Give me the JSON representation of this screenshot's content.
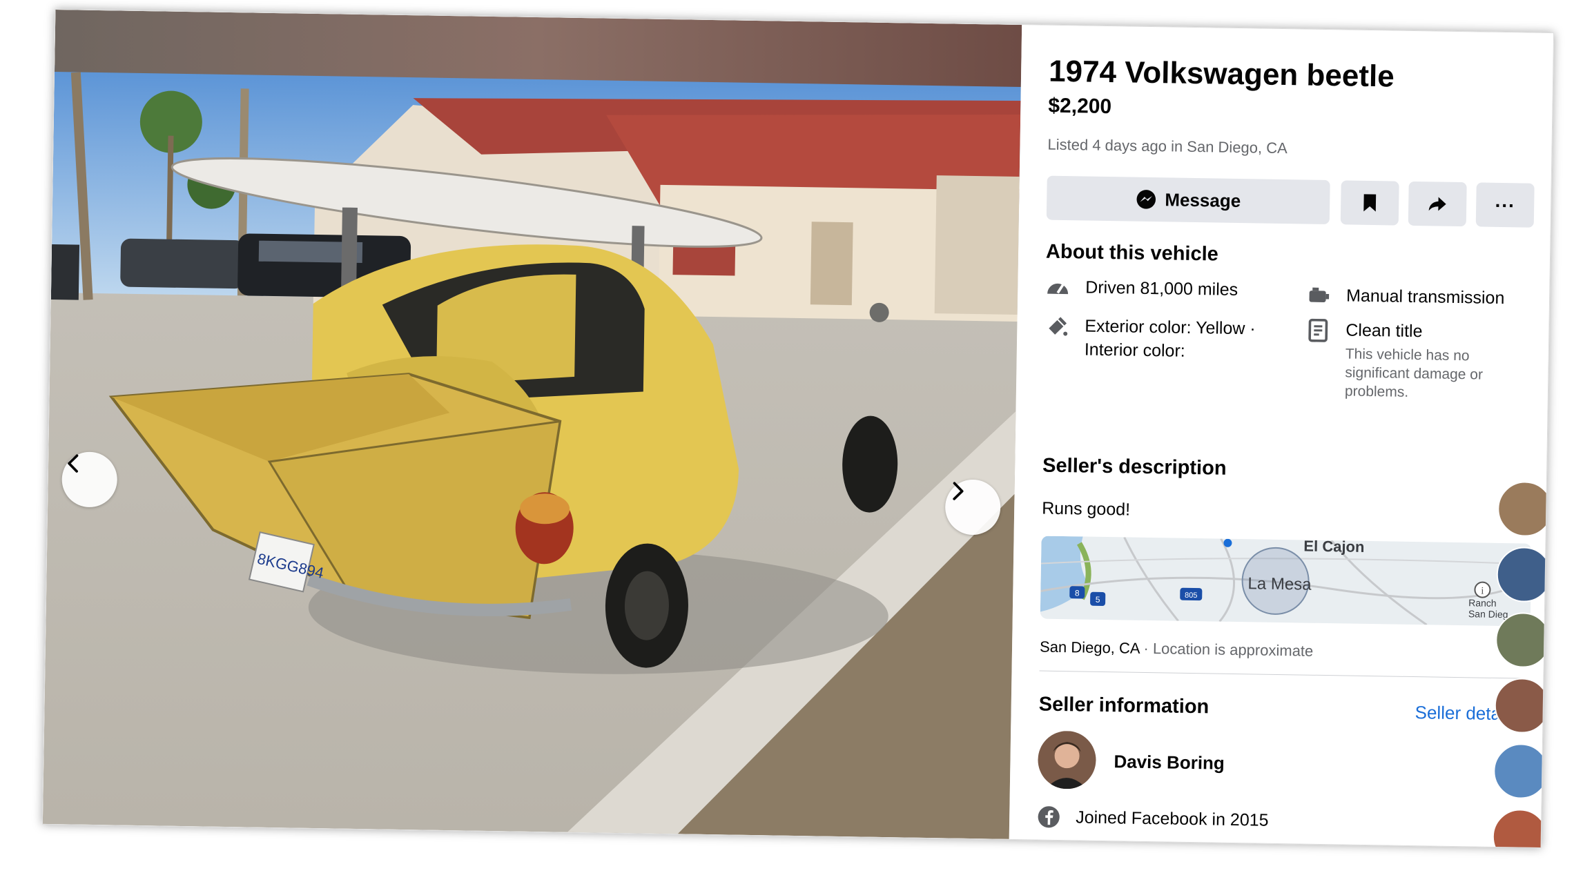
{
  "listing": {
    "title": "1974 Volkswagen beetle",
    "price": "$2,200",
    "listed": "Listed 4 days ago in San Diego, CA"
  },
  "actions": {
    "message_label": "Message",
    "icons": [
      "save-icon",
      "share-icon",
      "more-icon"
    ],
    "more_label": "..."
  },
  "about": {
    "heading": "About this vehicle",
    "driven": "Driven 81,000 miles",
    "transmission": "Manual transmission",
    "color_line1": "Exterior color: Yellow ·",
    "color_line2": "Interior color:",
    "title_status": "Clean title",
    "title_sub": "This vehicle has no significant damage or problems."
  },
  "description": {
    "heading": "Seller's description",
    "text": "Runs good!"
  },
  "map": {
    "label_main": "La Mesa",
    "label_top": "El Cajon",
    "label_small1": "Ranch",
    "label_small2": "San Dieg",
    "shields": [
      "8",
      "5",
      "805"
    ]
  },
  "location": {
    "city": "San Diego, CA",
    "note": "· Location is approximate"
  },
  "seller": {
    "heading": "Seller information",
    "details_link": "Seller detail",
    "name": "Davis Boring",
    "joined": "Joined Facebook in 2015"
  },
  "photo": {
    "plate": "8KGG894"
  },
  "colors": {
    "accent": "#1a6ed8",
    "button_bg": "#e4e6eb",
    "muted_text": "#65676b",
    "car_yellow": "#e3c652"
  }
}
